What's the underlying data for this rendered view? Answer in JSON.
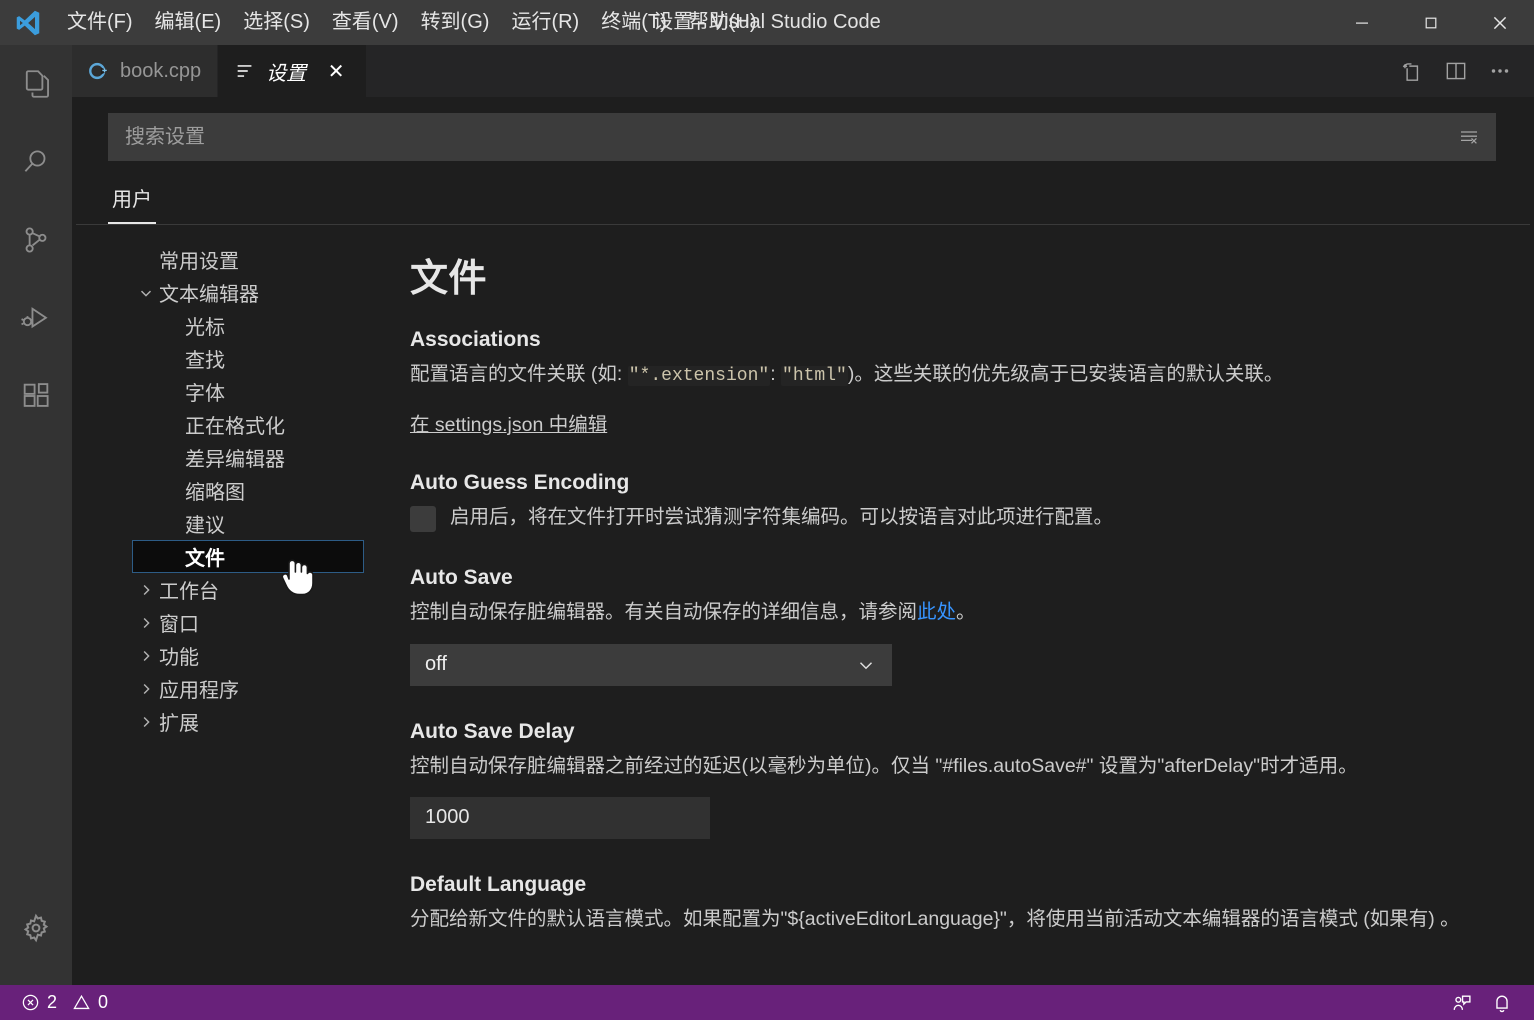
{
  "window": {
    "title": "设置 - Visual Studio Code",
    "logo_icon": "vscode-logo-icon",
    "controls": {
      "minimize": "minimize-icon",
      "maximize": "maximize-icon",
      "close": "close-icon"
    }
  },
  "menubar": {
    "items": [
      {
        "label": "文件(F)"
      },
      {
        "label": "编辑(E)"
      },
      {
        "label": "选择(S)"
      },
      {
        "label": "查看(V)"
      },
      {
        "label": "转到(G)"
      },
      {
        "label": "运行(R)"
      },
      {
        "label": "终端(T)"
      },
      {
        "label": "帮助(H)"
      }
    ]
  },
  "activitybar": {
    "items": [
      {
        "name": "explorer",
        "icon": "files-icon"
      },
      {
        "name": "search",
        "icon": "search-icon"
      },
      {
        "name": "source-control",
        "icon": "source-control-icon"
      },
      {
        "name": "run-debug",
        "icon": "run-and-debug-icon"
      },
      {
        "name": "extensions",
        "icon": "extensions-icon"
      }
    ],
    "bottom": [
      {
        "name": "manage",
        "icon": "gear-icon"
      }
    ]
  },
  "tabs": {
    "items": [
      {
        "label": "book.cpp",
        "icon": "cpp-file-icon",
        "active": false,
        "closable": false
      },
      {
        "label": "设置",
        "icon": "settings-list-icon",
        "active": true,
        "closable": true
      }
    ],
    "close_label": "✕",
    "actions": [
      {
        "name": "open-changes",
        "icon": "open-changes-icon"
      },
      {
        "name": "split-editor",
        "icon": "split-editor-icon"
      },
      {
        "name": "more-actions",
        "icon": "more-actions-icon"
      }
    ]
  },
  "search": {
    "placeholder": "搜索设置",
    "value": "",
    "clear_filter_icon": "clear-filter-icon"
  },
  "settings_tabs": {
    "items": [
      {
        "label": "用户",
        "active": true
      }
    ]
  },
  "toc": {
    "items": [
      {
        "label": "常用设置",
        "level": 0,
        "twisty": "",
        "selected": false
      },
      {
        "label": "文本编辑器",
        "level": 0,
        "twisty": "expanded",
        "selected": false
      },
      {
        "label": "光标",
        "level": 1,
        "twisty": "",
        "selected": false
      },
      {
        "label": "查找",
        "level": 1,
        "twisty": "",
        "selected": false
      },
      {
        "label": "字体",
        "level": 1,
        "twisty": "",
        "selected": false
      },
      {
        "label": "正在格式化",
        "level": 1,
        "twisty": "",
        "selected": false
      },
      {
        "label": "差异编辑器",
        "level": 1,
        "twisty": "",
        "selected": false
      },
      {
        "label": "缩略图",
        "level": 1,
        "twisty": "",
        "selected": false
      },
      {
        "label": "建议",
        "level": 1,
        "twisty": "",
        "selected": false
      },
      {
        "label": "文件",
        "level": 1,
        "twisty": "",
        "selected": true
      },
      {
        "label": "工作台",
        "level": 0,
        "twisty": "collapsed",
        "selected": false
      },
      {
        "label": "窗口",
        "level": 0,
        "twisty": "collapsed",
        "selected": false
      },
      {
        "label": "功能",
        "level": 0,
        "twisty": "collapsed",
        "selected": false
      },
      {
        "label": "应用程序",
        "level": 0,
        "twisty": "collapsed",
        "selected": false
      },
      {
        "label": "扩展",
        "level": 0,
        "twisty": "collapsed",
        "selected": false
      }
    ]
  },
  "content": {
    "page_title": "文件",
    "associations": {
      "title": "Associations",
      "desc_a": "配置语言的文件关联 (如: ",
      "code_1": "\"*.extension\"",
      "desc_b": ": ",
      "code_2": "\"html\"",
      "desc_c": ")。这些关联的优先级高于已安装语言的默认关联。",
      "edit_link": "在 settings.json 中编辑"
    },
    "auto_guess_encoding": {
      "title": "Auto Guess Encoding",
      "checked": false,
      "label": "启用后，将在文件打开时尝试猜测字符集编码。可以按语言对此项进行配置。"
    },
    "auto_save": {
      "title": "Auto Save",
      "desc_a": "控制自动保存脏编辑器。有关自动保存的详细信息，请参阅",
      "link_text": "此处",
      "desc_b": "。",
      "value": "off",
      "chevron_icon": "chevron-down-icon"
    },
    "auto_save_delay": {
      "title": "Auto Save Delay",
      "desc": "控制自动保存脏编辑器之前经过的延迟(以毫秒为单位)。仅当 \"#files.autoSave#\" 设置为\"afterDelay\"时才适用。",
      "value": "1000"
    },
    "default_language": {
      "title": "Default Language",
      "desc": "分配给新文件的默认语言模式。如果配置为\"${activeEditorLanguage}\"，将使用当前活动文本编辑器的语言模式 (如果有) 。"
    }
  },
  "statusbar": {
    "background": "#68217a",
    "errors_icon": "error-icon",
    "errors_count": "2",
    "warnings_icon": "warning-icon",
    "warnings_count": "0",
    "right": [
      {
        "name": "feedback",
        "icon": "feedback-icon"
      },
      {
        "name": "notifications",
        "icon": "bell-icon"
      }
    ]
  },
  "colors": {
    "accent": "#007fd4",
    "link": "#3794ff",
    "status_bar": "#68217a",
    "titlebar": "#3c3c3c",
    "activitybar": "#333333",
    "editor_bg": "#1e1e1e",
    "code_text": "#ccc4ab",
    "focus_border": "#2d5c86"
  }
}
